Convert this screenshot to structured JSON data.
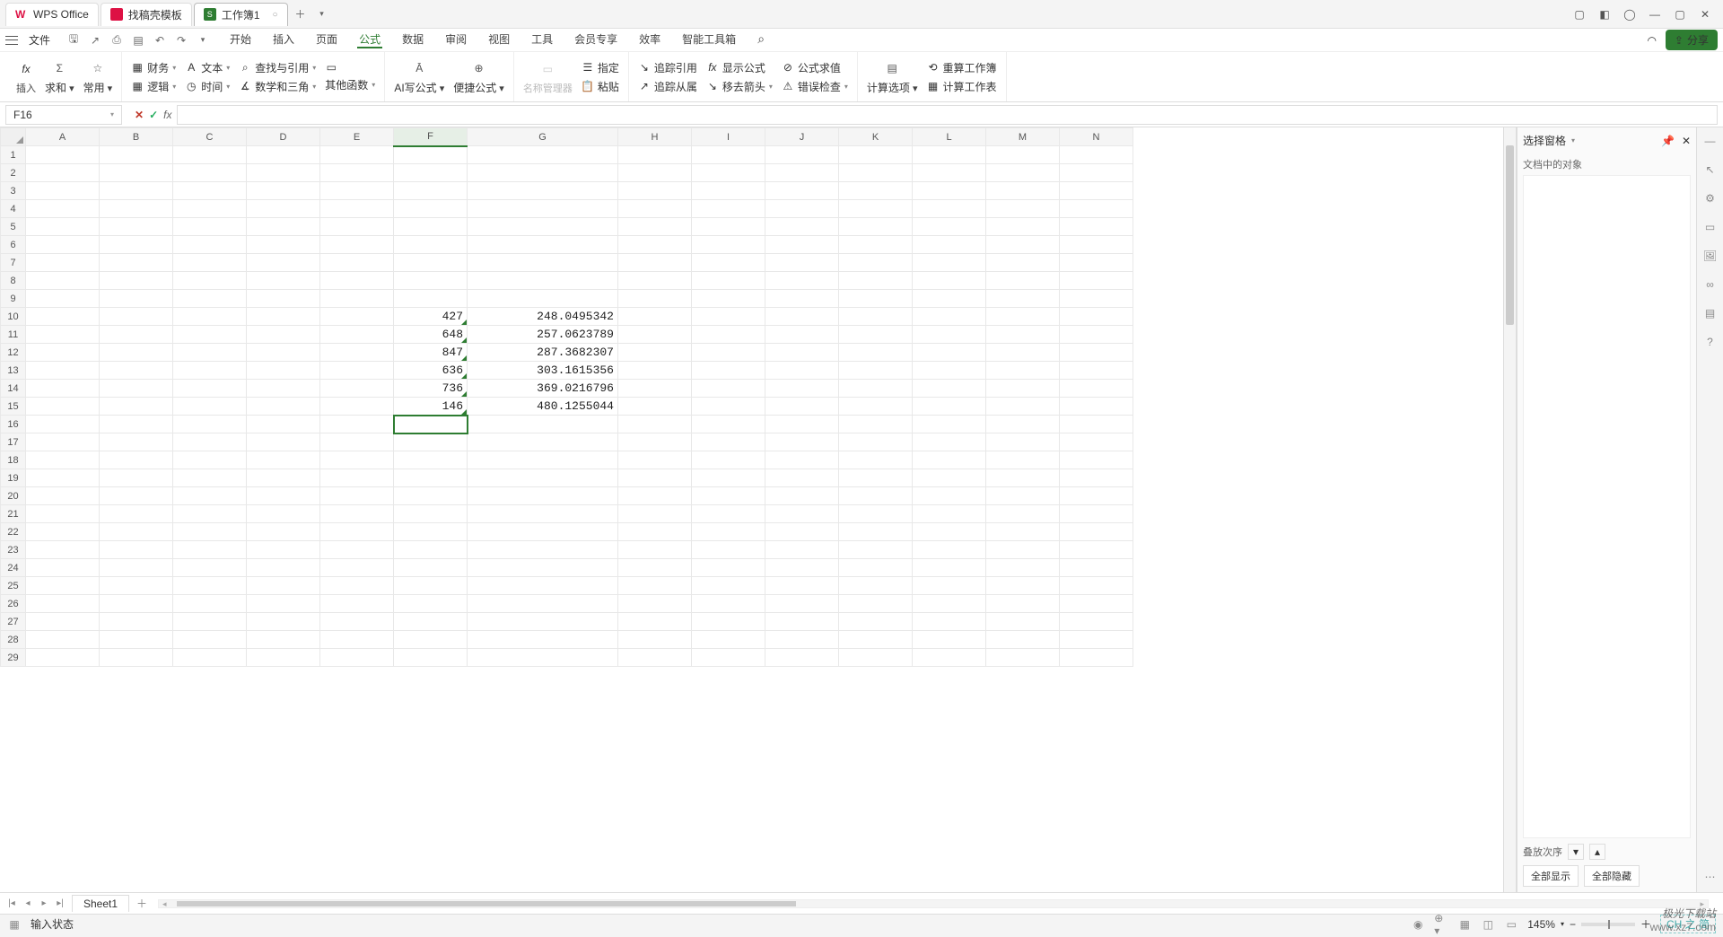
{
  "titlebar": {
    "tabs": [
      {
        "label": "WPS Office",
        "icon": "wps-logo",
        "color": "#d14"
      },
      {
        "label": "找稿壳模板",
        "icon": "doc-red"
      },
      {
        "label": "工作簿1",
        "icon": "sheet-green",
        "closeable": true
      }
    ]
  },
  "menubar": {
    "file": "文件",
    "tabs": [
      "开始",
      "插入",
      "页面",
      "公式",
      "数据",
      "审阅",
      "视图",
      "工具",
      "会员专享",
      "效率",
      "智能工具箱"
    ],
    "active": "公式",
    "share": "分享"
  },
  "ribbon": {
    "g1": {
      "insert": "插入",
      "sum": "求和",
      "common": "常用"
    },
    "g2": {
      "finance": "财务",
      "text": "文本",
      "lookup": "查找与引用",
      "logic": "逻辑",
      "time": "时间",
      "math": "数学和三角",
      "other": "其他函数",
      "ebox": "□"
    },
    "g3": {
      "ai": "AI写公式",
      "quick": "便捷公式"
    },
    "g4": {
      "name": "名称管理器",
      "assign": "指定",
      "paste": "粘贴"
    },
    "g5": {
      "trace_ref": "追踪引用",
      "show_fx": "显示公式",
      "fx_val": "公式求值",
      "trace_dep": "追踪从属",
      "rm_arrow": "移去箭头",
      "err_chk": "错误检查"
    },
    "g6": {
      "calc_opt": "计算选项"
    },
    "g7": {
      "recalc_book": "重算工作簿",
      "calc_sheet": "计算工作表"
    }
  },
  "formula_bar": {
    "cell_ref": "F16"
  },
  "columns": [
    "A",
    "B",
    "C",
    "D",
    "E",
    "F",
    "G",
    "H",
    "I",
    "J",
    "K",
    "L",
    "M",
    "N"
  ],
  "col_widths": {
    "default": 82,
    "G": 168
  },
  "row_count": 29,
  "selected": {
    "col": "F",
    "row": 16
  },
  "cells": {
    "F10": "427",
    "G10": "248.0495342",
    "F11": "648",
    "G11": "257.0623789",
    "F12": "847",
    "G12": "287.3682307",
    "F13": "636",
    "G13": "303.1615356",
    "F14": "736",
    "G14": "369.0216796",
    "F15": "146",
    "G15": "480.1255044"
  },
  "sidepanel": {
    "title": "选择窗格",
    "objects": "文档中的对象",
    "stack": "叠放次序",
    "show_all": "全部显示",
    "hide_all": "全部隐藏"
  },
  "sheetbar": {
    "sheet": "Sheet1"
  },
  "statusbar": {
    "mode": "输入状态",
    "zoom": "145%",
    "ime": "CH 之 简"
  },
  "watermark": {
    "a": "极光下载站",
    "b": "www.xz7.com"
  }
}
